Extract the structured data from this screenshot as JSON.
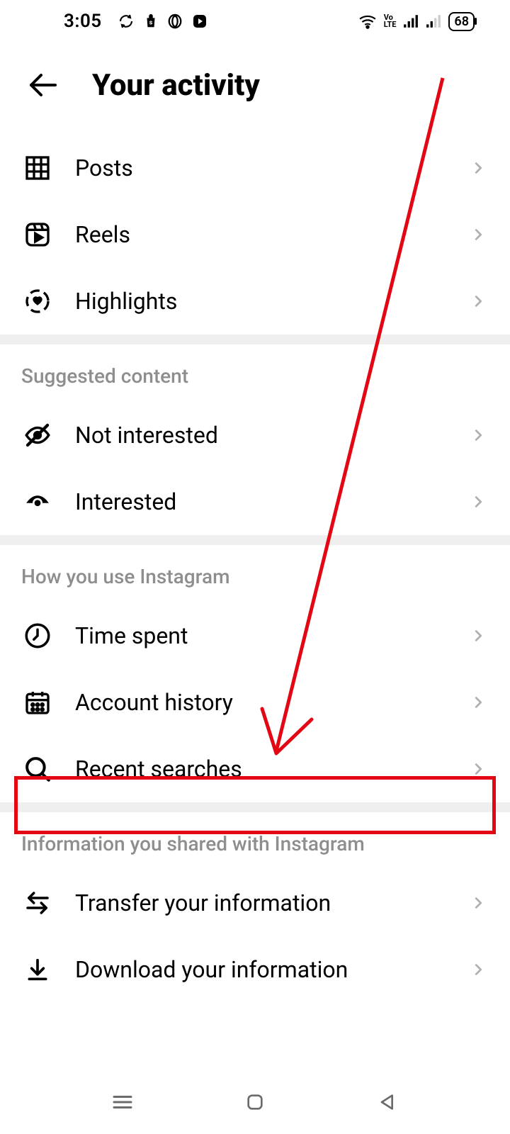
{
  "status_bar": {
    "time": "3:05",
    "battery": "68"
  },
  "header": {
    "title": "Your activity"
  },
  "sections": {
    "content": {
      "posts": "Posts",
      "reels": "Reels",
      "highlights": "Highlights"
    },
    "suggested": {
      "header": "Suggested content",
      "not_interested": "Not interested",
      "interested": "Interested"
    },
    "usage": {
      "header": "How you use Instagram",
      "time_spent": "Time spent",
      "account_history": "Account history",
      "recent_searches": "Recent searches"
    },
    "shared": {
      "header": "Information you shared with Instagram",
      "transfer": "Transfer your information",
      "download": "Download your information"
    }
  }
}
